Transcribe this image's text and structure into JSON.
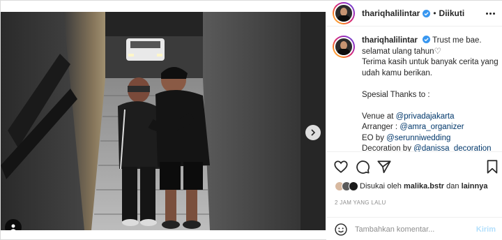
{
  "post": {
    "username": "thariqhalilintar",
    "separator": "•",
    "follow_status": "Diikuti"
  },
  "caption": {
    "username": "thariqhalilintar",
    "lines": [
      "Trust me bae.",
      "selamat ulang tahun♡",
      "Terima kasih untuk banyak cerita yang",
      "udah kamu berikan.",
      "",
      "Spesial Thanks to :",
      "",
      "Venue at ",
      "Arranger : ",
      "EO by ",
      "Decoration by "
    ],
    "links": {
      "venue": "@privadajakarta",
      "arranger": "@amra_organizer",
      "eo": "@serunniwedding",
      "decoration": "@danissa_decoration"
    }
  },
  "likes": {
    "prefix": "Disukai oleh",
    "user": "malika.bstr",
    "conjunction": "dan",
    "others": "lainnya"
  },
  "timestamp": "2 JAM YANG LALU",
  "comment": {
    "placeholder": "Tambahkan komentar...",
    "post_label": "Kirim"
  },
  "icons": {
    "like": "heart-icon",
    "comment": "comment-icon",
    "share": "paper-plane-icon",
    "save": "bookmark-icon",
    "emoji": "smiley-icon",
    "next": "chevron-right-icon",
    "tag": "user-tag-icon",
    "verified": "verified-badge-icon",
    "more": "more-dots-icon"
  },
  "colors": {
    "verified": "#3897f0",
    "link": "#00376b",
    "post_button": "#b2dffc",
    "active_dot": "#3897f0"
  },
  "carousel": {
    "slide_count": 6,
    "active_index": 0
  }
}
